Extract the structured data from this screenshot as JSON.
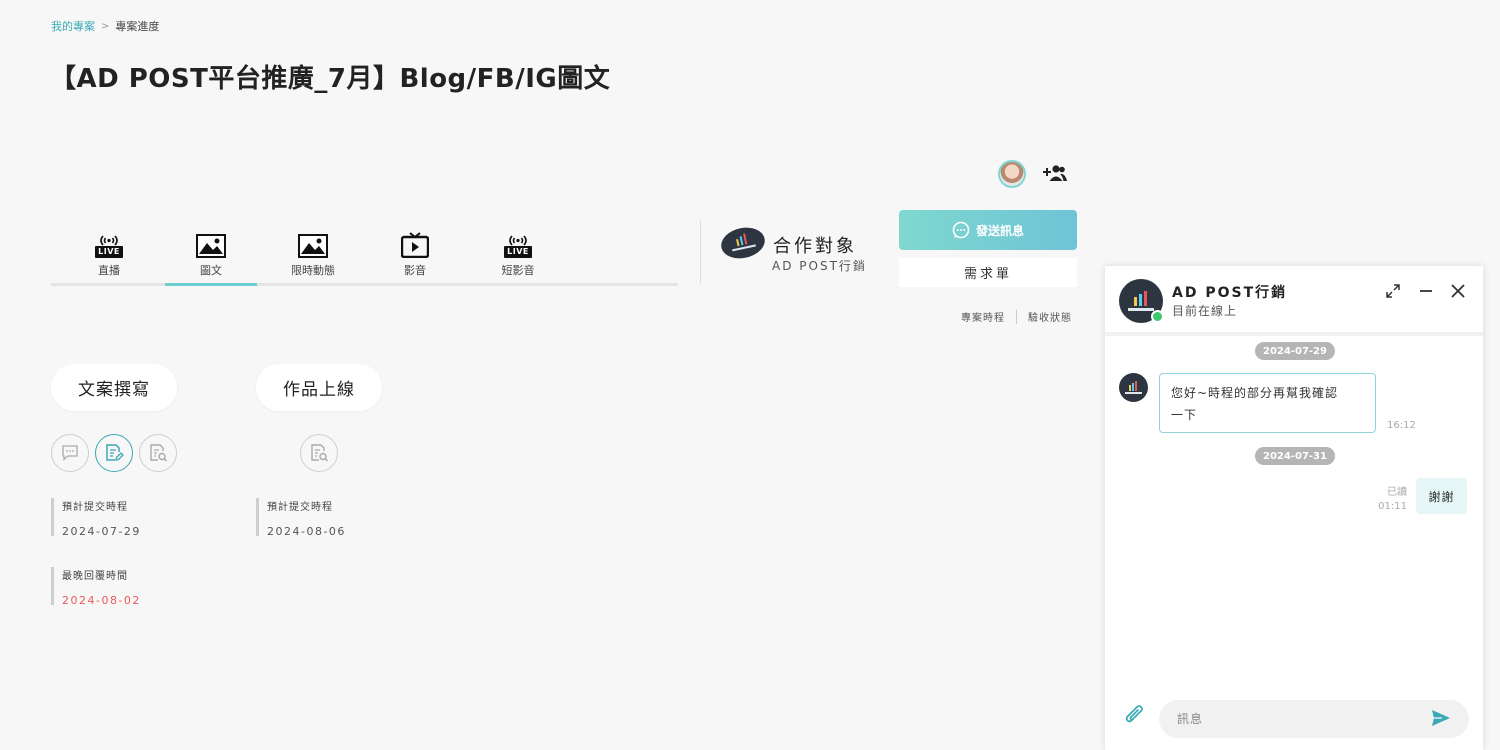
{
  "breadcrumb": {
    "home": "我的專案",
    "separator": ">",
    "current": "專案進度"
  },
  "page_title": "【AD POST平台推廣_7月】Blog/FB/IG圖文",
  "tabs": [
    {
      "label": "直播",
      "icon": "live-icon",
      "badge": "LIVE"
    },
    {
      "label": "圖文",
      "icon": "image-icon"
    },
    {
      "label": "限時動態",
      "icon": "image-icon"
    },
    {
      "label": "影音",
      "icon": "tv-play-icon"
    },
    {
      "label": "短影音",
      "icon": "live-icon",
      "badge": "LIVE"
    }
  ],
  "active_tab": "圖文",
  "partner": {
    "title": "合作對象",
    "name": "AD POST行銷"
  },
  "buttons": {
    "send_message": "發送訊息",
    "requirement": "需求單"
  },
  "sub_links": {
    "timeline": "專案時程",
    "acceptance": "驗收狀態"
  },
  "stages": [
    {
      "title": "文案撰寫",
      "expected_label": "預計提交時程",
      "expected_date": "2024-07-29",
      "latest_label": "最晚回覆時間",
      "latest_date": "2024-08-02"
    },
    {
      "title": "作品上線",
      "expected_label": "預計提交時程",
      "expected_date": "2024-08-06"
    }
  ],
  "chat": {
    "name": "AD POST行銷",
    "status": "目前在線上",
    "messages": [
      {
        "date": "2024-07-29",
        "text_line1": "您好~時程的部分再幫我確認",
        "text_line2": "一下",
        "time": "16:12"
      },
      {
        "date": "2024-07-31",
        "text": "謝謝",
        "read": "已讀",
        "time": "01:11"
      }
    ],
    "input_placeholder": "訊息"
  },
  "colors": {
    "accent": "#3aa9b6",
    "button_gradient_start": "#7fd8cf",
    "button_gradient_end": "#6fc3d6",
    "deadline_red": "#e85a5a",
    "online_green": "#3cc96a"
  }
}
